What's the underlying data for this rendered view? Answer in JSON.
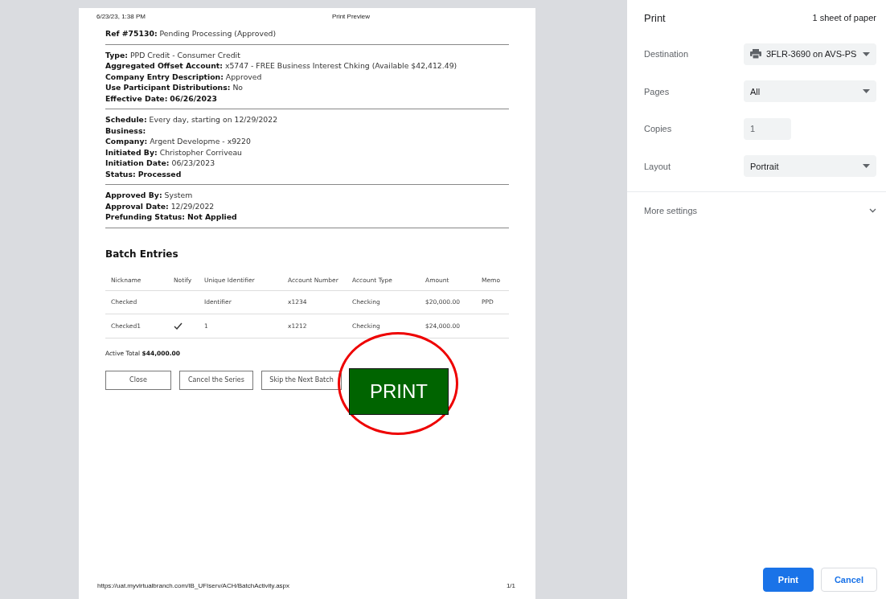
{
  "preview": {
    "header_date": "6/23/23, 1:38 PM",
    "header_title": "Print Preview",
    "ref_label": "Ref #75130:",
    "ref_value": "Pending Processing (Approved)",
    "sections": [
      [
        {
          "label": "Type:",
          "value": "PPD Credit - Consumer Credit",
          "bold": false
        },
        {
          "label": "Aggregated Offset Account:",
          "value": "x5747 - FREE Business Interest Chking (Available $42,412.49)",
          "bold": false
        },
        {
          "label": "Company Entry Description:",
          "value": "Approved",
          "bold": false
        },
        {
          "label": "Use Participant Distributions:",
          "value": "No",
          "bold": false
        },
        {
          "label": "Effective Date:",
          "value": "06/26/2023",
          "bold": true
        }
      ],
      [
        {
          "label": "Schedule:",
          "value": "Every day, starting on 12/29/2022",
          "bold": false
        },
        {
          "label": "Business:"
        },
        {
          "label": "Company:",
          "value": "Argent Developme - x9220",
          "bold": false
        },
        {
          "label": "Initiated By:",
          "value": "Christopher Corriveau",
          "bold": false
        },
        {
          "label": "Initiation Date:",
          "value": "06/23/2023",
          "bold": false
        },
        {
          "label": "Status:",
          "value": "Processed",
          "bold": true
        }
      ],
      [
        {
          "label": "Approved By:",
          "value": "System",
          "bold": false
        },
        {
          "label": "Approval Date:",
          "value": "12/29/2022",
          "bold": false
        },
        {
          "label": "Prefunding Status:",
          "value": "Not Applied",
          "bold": true
        }
      ]
    ],
    "batch_title": "Batch Entries",
    "table": {
      "columns": [
        "Nickname",
        "Notify",
        "Unique Identifier",
        "Account Number",
        "Account Type",
        "Amount",
        "Memo"
      ],
      "rows": [
        {
          "nickname": "Checked",
          "notify": false,
          "identifier": "Identifier",
          "account_number": "x1234",
          "account_type": "Checking",
          "amount": "$20,000.00",
          "memo": "PPD"
        },
        {
          "nickname": "Checked1",
          "notify": true,
          "identifier": "1",
          "account_number": "x1212",
          "account_type": "Checking",
          "amount": "$24,000.00"
        }
      ]
    },
    "total_label": "Active Total",
    "total_value": "$44,000.00",
    "buttons": [
      "Close",
      "Cancel the Series",
      "Skip the Next Batch"
    ],
    "annotation": "PRINT",
    "footer_url": "https://uat.myvirtualbranch.com/IB_UFIserv/ACH/BatchActivity.aspx",
    "footer_page": "1/1"
  },
  "panel": {
    "title": "Print",
    "sheets": "1 sheet of paper",
    "settings": [
      {
        "kind": "printer",
        "label": "Destination",
        "value": "3FLR-3690 on AVS-PS"
      },
      {
        "kind": "select",
        "label": "Pages",
        "value": "All"
      },
      {
        "kind": "input",
        "label": "Copies",
        "value": "1"
      },
      {
        "kind": "select",
        "label": "Layout",
        "value": "Portrait"
      }
    ],
    "more_settings": "More settings",
    "actions": [
      {
        "label": "Print",
        "primary": true
      },
      {
        "label": "Cancel",
        "primary": false
      }
    ]
  }
}
